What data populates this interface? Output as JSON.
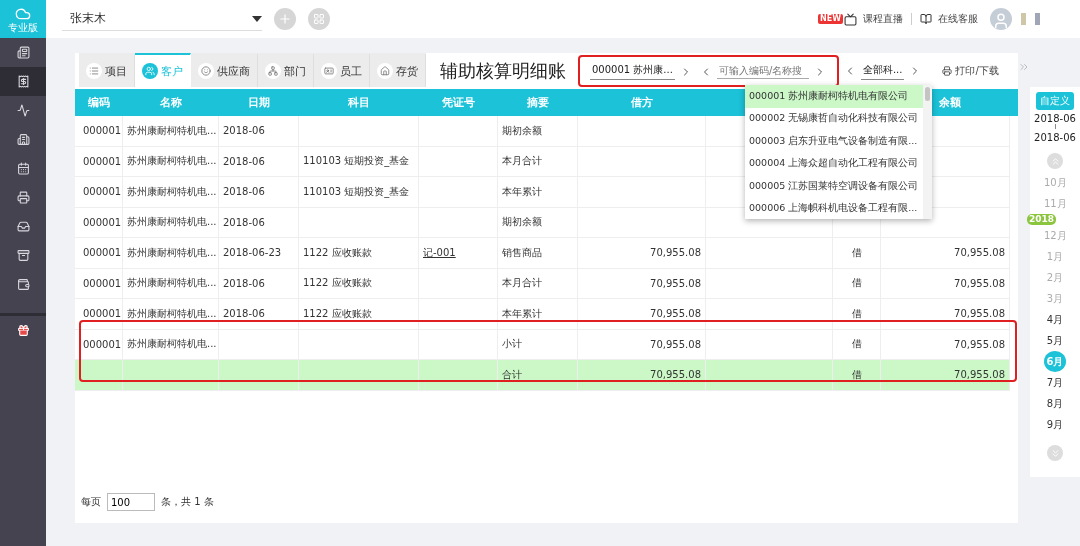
{
  "logo": {
    "label": "专业版"
  },
  "sidebar": {
    "items": [
      {
        "selected": false
      },
      {
        "selected": true
      },
      {
        "selected": false
      },
      {
        "selected": false
      },
      {
        "selected": false
      },
      {
        "selected": false
      },
      {
        "selected": false
      },
      {
        "selected": false
      },
      {
        "selected": false
      },
      {
        "selected": false
      }
    ]
  },
  "topbar": {
    "account": "张末木",
    "live_badge": "NEW",
    "live_label": "课程直播",
    "service_label": "在线客服"
  },
  "tabs": [
    {
      "label": "项目",
      "selected": false
    },
    {
      "label": "客户",
      "selected": true
    },
    {
      "label": "供应商",
      "selected": false
    },
    {
      "label": "部门",
      "selected": false
    },
    {
      "label": "员工",
      "selected": false
    },
    {
      "label": "存货",
      "selected": false
    }
  ],
  "title": "辅助核算明细账",
  "filters": {
    "entity": "000001  苏州康...",
    "search_placeholder": "可输入编码/名称搜",
    "subject": "全部科...",
    "print_label": "打印/下载"
  },
  "dropdown": {
    "options": [
      {
        "label": "000001 苏州康耐柯特机电有限公司",
        "selected": true
      },
      {
        "label": "000002 无锡康哲自动化科技有限公司",
        "selected": false
      },
      {
        "label": "000003 启东升亚电气设备制造有限...",
        "selected": false
      },
      {
        "label": "000004 上海众超自动化工程有限公司",
        "selected": false
      },
      {
        "label": "000005 江苏国莱特空调设备有限公司",
        "selected": false
      },
      {
        "label": "000006 上海帜科机电设备工程有限...",
        "selected": false
      }
    ]
  },
  "table": {
    "columns": [
      "编码",
      "名称",
      "日期",
      "科目",
      "凭证号",
      "摘要",
      "借方",
      "余额"
    ],
    "rows": [
      {
        "kind": "normal",
        "code": "000001",
        "name": "苏州康耐柯特机电...",
        "date": "2018-06",
        "summary": "期初余额"
      },
      {
        "kind": "normal",
        "code": "000001",
        "name": "苏州康耐柯特机电...",
        "date": "2018-06",
        "subject": "110103 短期投资_基金",
        "summary": "本月合计"
      },
      {
        "kind": "normal",
        "code": "000001",
        "name": "苏州康耐柯特机电...",
        "date": "2018-06",
        "subject": "110103 短期投资_基金",
        "summary": "本年累计"
      },
      {
        "kind": "normal",
        "code": "000001",
        "name": "苏州康耐柯特机电...",
        "date": "2018-06",
        "summary": "期初余额"
      },
      {
        "kind": "normal",
        "code": "000001",
        "name": "苏州康耐柯特机电...",
        "date": "2018-06-23",
        "subject": "1122 应收账款",
        "voucher": "记-001",
        "summary": "销售商品",
        "debit": "70,955.08",
        "column_9": "借",
        "balance": "70,955.08"
      },
      {
        "kind": "normal",
        "code": "000001",
        "name": "苏州康耐柯特机电...",
        "date": "2018-06",
        "subject": "1122 应收账款",
        "summary": "本月合计",
        "debit": "70,955.08",
        "column_9": "借",
        "balance": "70,955.08"
      },
      {
        "kind": "normal",
        "code": "000001",
        "name": "苏州康耐柯特机电...",
        "date": "2018-06",
        "subject": "1122 应收账款",
        "summary": "本年累计",
        "debit": "70,955.08",
        "column_9": "借",
        "balance": "70,955.08"
      },
      {
        "kind": "normal",
        "code": "000001",
        "name": "苏州康耐柯特机电...",
        "summary": "小计",
        "debit": "70,955.08",
        "column_9": "借",
        "balance": "70,955.08"
      },
      {
        "kind": "total",
        "summary": "合计",
        "debit": "70,955.08",
        "column_9": "借",
        "balance": "70,955.08"
      }
    ]
  },
  "pager": {
    "per_page_label": "每页",
    "per_page": "100",
    "count_label": "条，共 1 条"
  },
  "period_panel": {
    "mode_label": "自定义",
    "start": "2018-06",
    "end": "2018-06",
    "year_badge": "2018",
    "months": [
      {
        "label": "10月",
        "faded": true,
        "selected": false
      },
      {
        "label": "11月",
        "faded": true,
        "selected": false
      },
      {
        "label": "12月",
        "faded": true,
        "selected": false
      },
      {
        "label": "1月",
        "faded": true,
        "selected": false
      },
      {
        "label": "2月",
        "faded": true,
        "selected": false
      },
      {
        "label": "3月",
        "faded": true,
        "selected": false
      },
      {
        "label": "4月",
        "faded": false,
        "selected": false
      },
      {
        "label": "5月",
        "faded": false,
        "selected": false
      },
      {
        "label": "6月",
        "faded": false,
        "selected": true
      },
      {
        "label": "7月",
        "faded": false,
        "selected": false
      },
      {
        "label": "8月",
        "faded": false,
        "selected": false
      },
      {
        "label": "9月",
        "faded": false,
        "selected": false
      }
    ]
  }
}
